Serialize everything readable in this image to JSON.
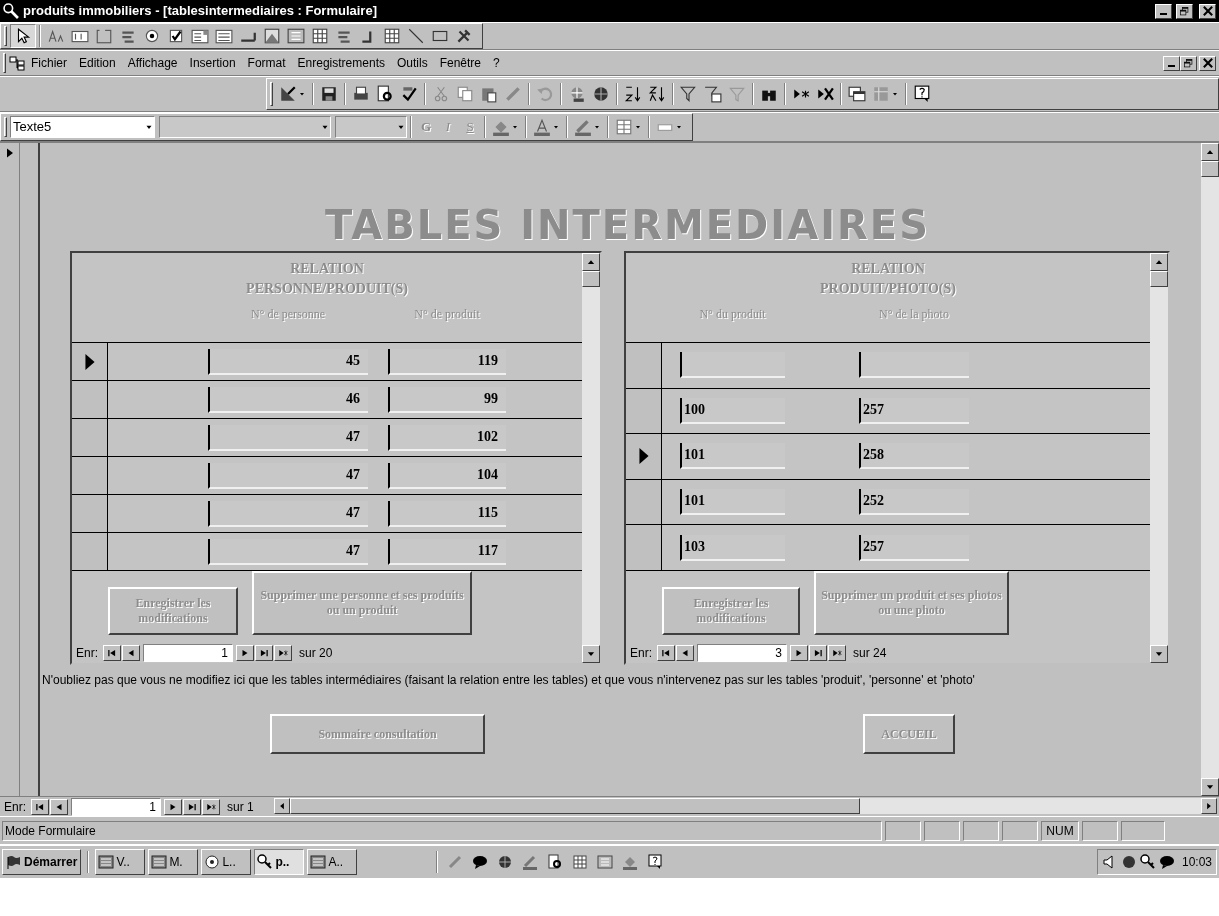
{
  "window": {
    "title": "produits immobiliers - [tablesintermediaires : Formulaire]"
  },
  "menu": [
    {
      "label": "Fichier"
    },
    {
      "label": "Edition"
    },
    {
      "label": "Affichage"
    },
    {
      "label": "Insertion"
    },
    {
      "label": "Format"
    },
    {
      "label": "Enregistrements"
    },
    {
      "label": "Outils"
    },
    {
      "label": "Fenêtre"
    },
    {
      "label": "?"
    }
  ],
  "format_toolbar": {
    "object": "Texte5",
    "style_buttons": [
      "G",
      "I",
      "S"
    ]
  },
  "form": {
    "title": "TABLES INTERMEDIAIRES",
    "subforms": [
      {
        "title_lines": [
          "RELATION",
          "PERSONNE/PRODUIT(S)"
        ],
        "columns": [
          "N° de personne",
          "N° de produit"
        ],
        "rows": [
          {
            "kind": "record",
            "cells": [
              "45",
              "119"
            ],
            "selected": true
          },
          {
            "kind": "record",
            "cells": [
              "46",
              "99"
            ],
            "selected": false
          },
          {
            "kind": "record",
            "cells": [
              "47",
              "102"
            ],
            "selected": false
          },
          {
            "kind": "record",
            "cells": [
              "47",
              "104"
            ],
            "selected": false
          },
          {
            "kind": "record",
            "cells": [
              "47",
              "115"
            ],
            "selected": false
          },
          {
            "kind": "record",
            "cells": [
              "47",
              "117"
            ],
            "selected": false
          }
        ],
        "buttons": [
          {
            "label": "Enregistrer les modifications",
            "disabled": true
          },
          {
            "label": "Supprimer une personne et ses produits ou un produit",
            "disabled": true
          }
        ],
        "nav": {
          "label": "Enr:",
          "current": "1",
          "total": "sur 20"
        }
      },
      {
        "title_lines": [
          "RELATION",
          "PRODUIT/PHOTO(S)"
        ],
        "columns": [
          "N° du produit",
          "N° de la photo"
        ],
        "rows": [
          {
            "kind": "blank",
            "selected": false
          },
          {
            "kind": "record",
            "cells": [
              "100",
              "257"
            ],
            "selected": false
          },
          {
            "kind": "record",
            "cells": [
              "101",
              "258"
            ],
            "selected": true
          },
          {
            "kind": "record",
            "cells": [
              "101",
              "252"
            ],
            "selected": false
          },
          {
            "kind": "record",
            "cells": [
              "103",
              "257"
            ],
            "selected": false
          }
        ],
        "buttons": [
          {
            "label": "Enregistrer les modifications",
            "disabled": true
          },
          {
            "label": "Supprimer un produit et ses photos ou une photo",
            "disabled": true
          }
        ],
        "nav": {
          "label": "Enr:",
          "current": "3",
          "total": "sur 24"
        }
      }
    ],
    "note": "N'oubliez pas que vous ne modifiez ici que les tables intermédiaires (faisant la relation entre les tables) et que vous n'intervenez pas sur les tables 'produit', 'personne' et 'photo'",
    "buttons": [
      {
        "label": "Sommaire consultation",
        "disabled": true
      },
      {
        "label": "ACCUEIL",
        "disabled": true
      }
    ],
    "nav": {
      "label": "Enr:",
      "current": "1",
      "total": "sur 1"
    }
  },
  "status_bar": {
    "mode": "Mode Formulaire",
    "indicators": [
      "NUM"
    ]
  },
  "taskbar": {
    "start": "Démarrer",
    "tasks": [
      {
        "label": "V..",
        "selected": false
      },
      {
        "label": "M.",
        "selected": false
      },
      {
        "label": "L..",
        "selected": false
      },
      {
        "label": "p..",
        "selected": true
      },
      {
        "label": "A..",
        "selected": false
      }
    ],
    "clock": "10:03"
  }
}
